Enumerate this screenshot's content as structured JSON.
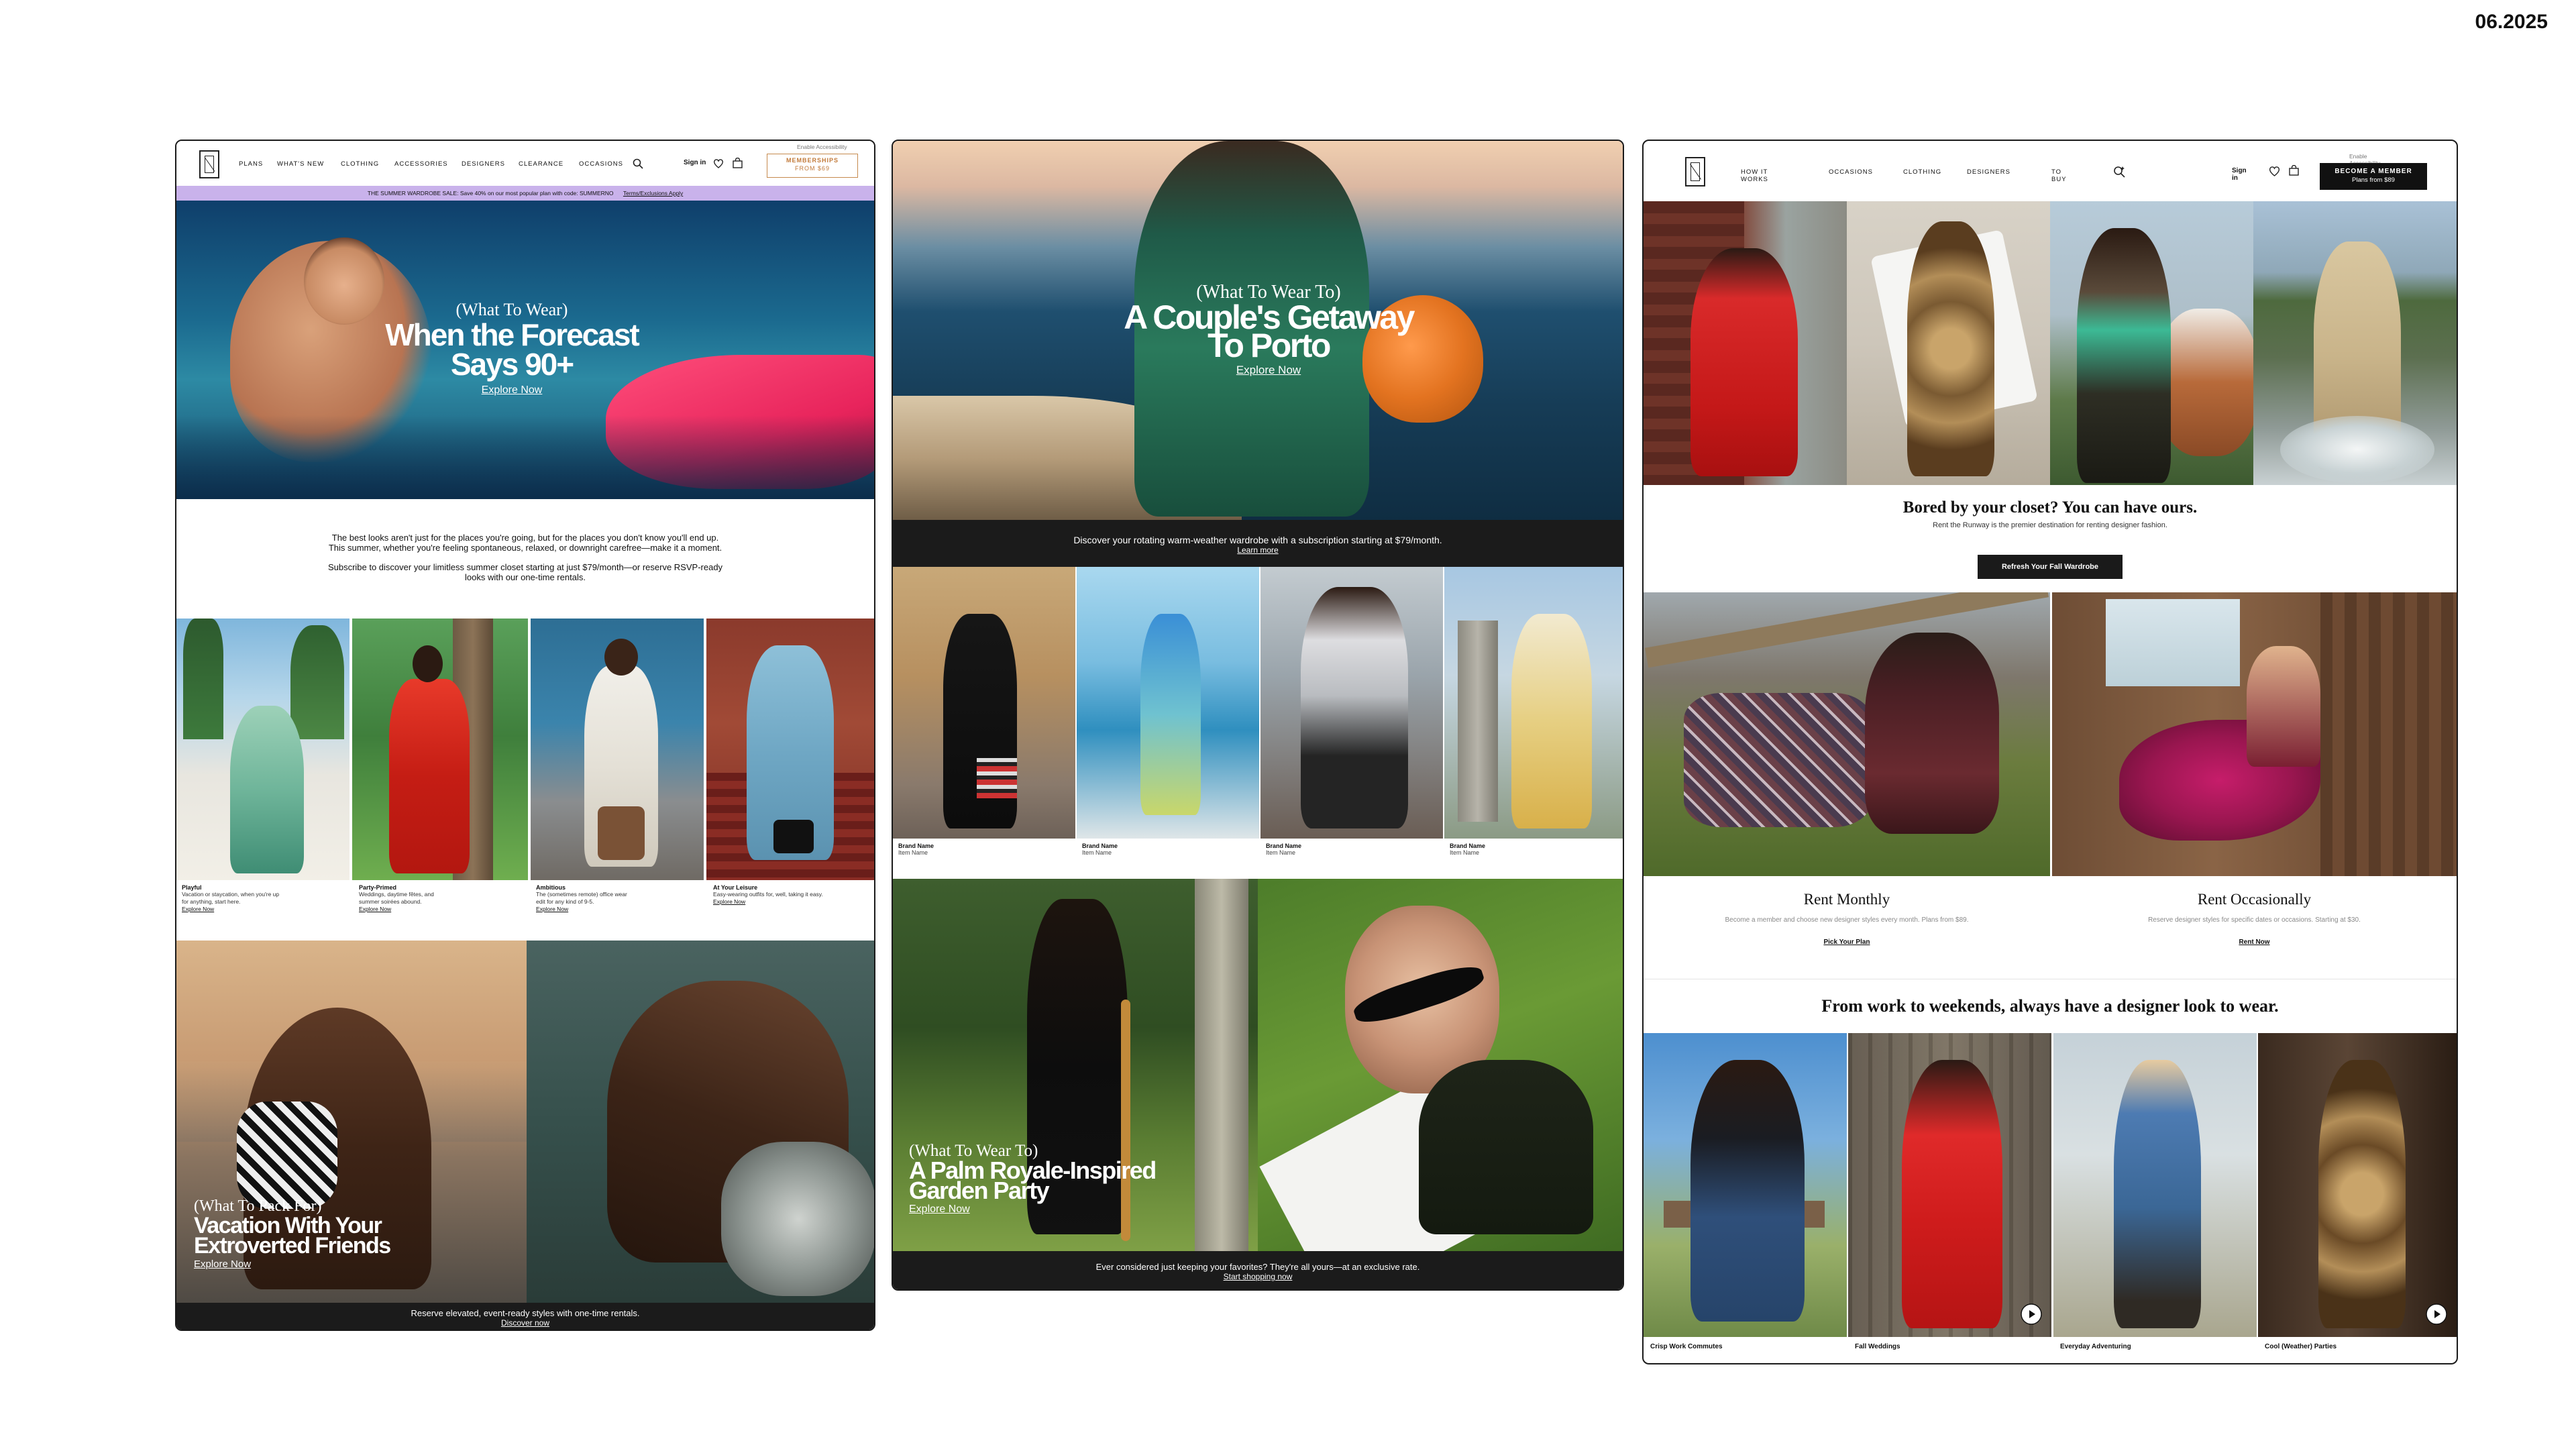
{
  "date": "06.2025",
  "card1": {
    "nav": [
      "PLANS",
      "WHAT'S NEW",
      "CLOTHING",
      "ACCESSORIES",
      "DESIGNERS",
      "CLEARANCE",
      "OCCASIONS"
    ],
    "accessibility": "Enable Accessibility",
    "sign_in": "Sign in",
    "membership_line1": "MEMBERSHIPS",
    "membership_line2": "FROM $69",
    "banner": "THE SUMMER WARDROBE SALE: Save 40% on our most popular plan with code: SUMMERNO",
    "banner_link": "Terms/Exclusions Apply",
    "hero_kicker": "(What To Wear)",
    "hero_title_1": "When the Forecast",
    "hero_title_2": "Says 90+",
    "hero_cta": "Explore Now",
    "intro_1": "The best looks aren't just for the places you're going, but for the places you don't know you'll end up.",
    "intro_2": "This summer, whether you're feeling spontaneous, relaxed, or downright carefree—make it a moment.",
    "intro_3": "Subscribe to discover your limitless summer closet starting at just $79/month—or reserve RSVP-ready",
    "intro_4": "looks with our one-time rentals.",
    "tiles": [
      {
        "title": "Playful",
        "body1": "Vacation or staycation, when you're up",
        "body2": "for anything, start here.",
        "cta": "Explore Now"
      },
      {
        "title": "Party-Primed",
        "body1": "Weddings, daytime fêtes, and",
        "body2": "summer soirées abound.",
        "cta": "Explore Now"
      },
      {
        "title": "Ambitious",
        "body1": "The (sometimes remote) office wear",
        "body2": "edit for any kind of 9-5.",
        "cta": "Explore Now"
      },
      {
        "title": "At Your Leisure",
        "body1": "Easy-wearing outfits for, well, taking it easy.",
        "body2": "",
        "cta": "Explore Now"
      }
    ],
    "pack_kicker": "(What To Pack For)",
    "pack_title_1": "Vacation With Your",
    "pack_title_2": "Extroverted Friends",
    "pack_cta": "Explore Now",
    "footer_text": "Reserve elevated, event-ready styles with one-time rentals.",
    "footer_link": "Discover now"
  },
  "card2": {
    "hero_kicker": "(What To Wear To)",
    "hero_title_1": "A Couple's Getaway",
    "hero_title_2": "To Porto",
    "hero_cta": "Explore Now",
    "bar_text": "Discover your rotating warm-weather wardrobe with a subscription starting at $79/month.",
    "bar_link": "Learn more",
    "products": [
      {
        "brand": "Brand Name",
        "item": "Item Name"
      },
      {
        "brand": "Brand Name",
        "item": "Item Name"
      },
      {
        "brand": "Brand Name",
        "item": "Item Name"
      },
      {
        "brand": "Brand Name",
        "item": "Item Name"
      }
    ],
    "garden_kicker": "(What To Wear To)",
    "garden_title_1": "A Palm Royale-Inspired",
    "garden_title_2": "Garden Party",
    "garden_cta": "Explore Now",
    "footer_text": "Ever considered just keeping your favorites? They're all yours—at an exclusive rate.",
    "footer_link": "Start shopping now"
  },
  "card3": {
    "nav": [
      "HOW IT WORKS",
      "OCCASIONS",
      "CLOTHING",
      "DESIGNERS",
      "TO BUY"
    ],
    "accessibility": "Enable Accessibility",
    "sign_in": "Sign in",
    "member_line1": "BECOME A MEMBER",
    "member_line2": "Plans from $89",
    "headline": "Bored by your closet? You can have ours.",
    "subline": "Rent the Runway is the premier destination for renting designer fashion.",
    "cta": "Refresh Your Fall Wardrobe",
    "monthly_title": "Rent Monthly",
    "monthly_body": "Become a member and choose new designer styles every month. Plans from $89.",
    "monthly_link": "Pick Your Plan",
    "occ_title": "Rent Occasionally",
    "occ_body": "Reserve designer styles for specific dates or occasions. Starting at $30.",
    "occ_link": "Rent Now",
    "section_title": "From work to weekends, always have a designer look to wear.",
    "looks": [
      "Crisp Work Commutes",
      "Fall Weddings",
      "Everyday Adventuring",
      "Cool (Weather) Parties"
    ]
  }
}
